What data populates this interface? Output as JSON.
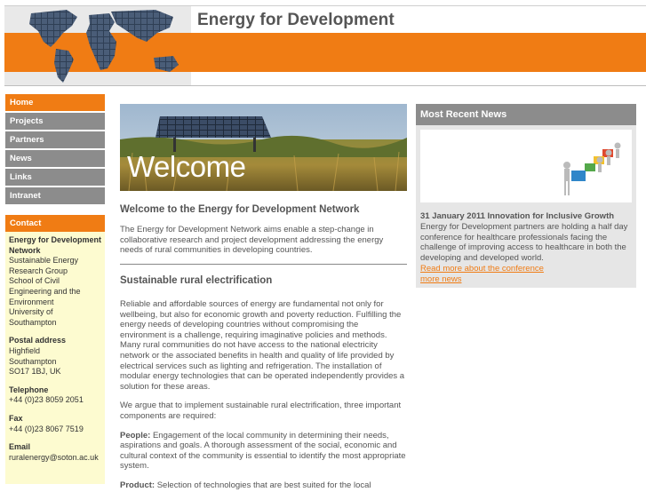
{
  "header": {
    "title": "Energy for Development",
    "accent_color": "#f07c14"
  },
  "nav": {
    "items": [
      "Home",
      "Projects",
      "Partners",
      "News",
      "Links",
      "Intranet"
    ],
    "active": "Home"
  },
  "contact": {
    "heading": "Contact",
    "org_name": "Energy for Development Network",
    "org_lines": [
      "Sustainable Energy Research Group",
      "School of Civil Engineering and the Environment",
      "University of Southampton"
    ],
    "postal_label": "Postal address",
    "postal_lines": [
      "Highfield",
      "Southampton",
      "SO17 1BJ, UK"
    ],
    "telephone_label": "Telephone",
    "telephone": "+44 (0)23 8059 2051",
    "fax_label": "Fax",
    "fax": "+44 (0)23 8067 7519",
    "email_label": "Email",
    "email": "ruralenergy@soton.ac.uk"
  },
  "main": {
    "banner_text": "Welcome",
    "intro_heading": "Welcome to the Energy for Development Network",
    "intro_text": "The Energy for Development Network aims enable a step-change in collaborative research and project development addressing the energy needs of rural communities in developing countries.",
    "section_heading": "Sustainable rural electrification",
    "para1": "Reliable and affordable sources of energy are fundamental not only for wellbeing, but also for economic growth and poverty reduction. Fulfilling the energy needs of developing countries without compromising the environment is a challenge, requiring imaginative policies and methods. Many rural communities do not have access to the national electricity network or the associated benefits in health and quality of life provided by electrical services such as lighting and refrigeration. The installation of modular energy technologies that can be operated independently provides a solution for these areas.",
    "para2": "We argue that to implement sustainable rural electrification, three important components are required:",
    "people_label": "People:",
    "people_text": " Engagement of the local community in determining their needs, aspirations and goals.  A thorough assessment of the social, economic and cultural context of the community is essential to identify the most appropriate system.",
    "product_label": "Product:",
    "product_text": " Selection of technologies that are best suited for the local"
  },
  "news": {
    "heading": "Most Recent News",
    "item_title": "31 January 2011 Innovation for Inclusive Growth",
    "item_text": "Energy for Development partners are holding a half day conference for healthcare professionals facing the challenge of improving access to healthcare in both the developing and developed world.",
    "read_more": "Read more about the conference",
    "more_news": "more news"
  }
}
